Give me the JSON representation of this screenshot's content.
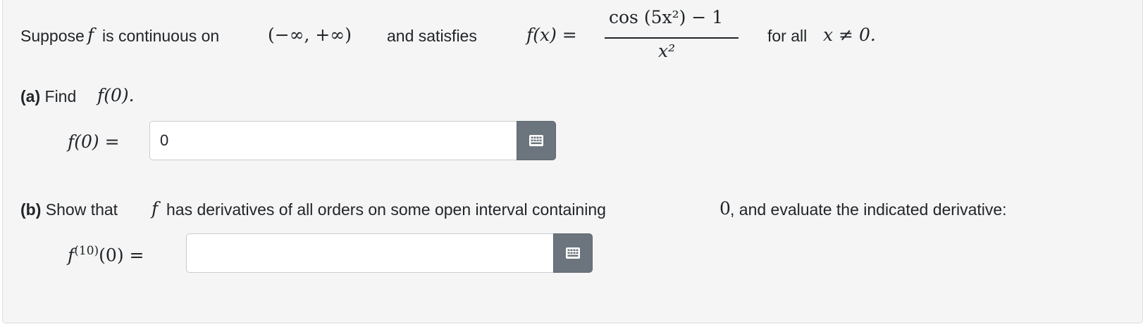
{
  "problem": {
    "intro_text": "Suppose",
    "f_symbol": "f",
    "continuity_text": "is continuous on",
    "interval": "(−∞, +∞)",
    "satisfies_text": "and satisfies",
    "func_lhs": "f(x) =",
    "numerator": "cos (5x²) − 1",
    "denominator": "x²",
    "condition_prefix": "for all",
    "condition_math": "x ≠ 0."
  },
  "part_a": {
    "label": "(a)",
    "instruction": "Find",
    "instruction_math": "f(0).",
    "answer_lhs": "f(0) =",
    "answer_value": "0"
  },
  "part_b": {
    "label": "(b)",
    "text_1": "Show that",
    "f_symbol": "f",
    "text_2": "has derivatives of all orders on some open interval containing",
    "zero": "0",
    "text_3": ", and evaluate the indicated derivative:",
    "answer_lhs_f": "f",
    "answer_lhs_order": "(10)",
    "answer_lhs_rest": "(0) =",
    "answer_value": ""
  },
  "icons": {
    "keyboard": "keyboard-icon"
  },
  "colors": {
    "button_bg": "#6c757d",
    "card_bg": "#f5f5f5"
  }
}
